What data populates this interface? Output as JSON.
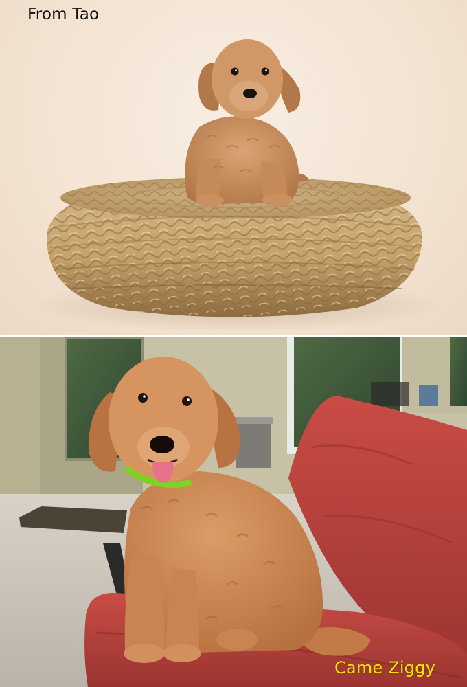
{
  "captions": {
    "top": "From Tao",
    "bottom": "Came Ziggy"
  },
  "photos": {
    "top": {
      "subject": "puppy-on-wicker-pouf"
    },
    "bottom": {
      "subject": "grown-dog-on-red-patio-chair"
    }
  },
  "colors": {
    "caption_top": "#111111",
    "caption_bottom": "#f4e500",
    "puppy_fur": "#c98d5c",
    "adult_fur": "#cf8b55",
    "wicker": "#c4a36e",
    "cushion_red": "#b8423c",
    "collar_green": "#7ed321"
  }
}
